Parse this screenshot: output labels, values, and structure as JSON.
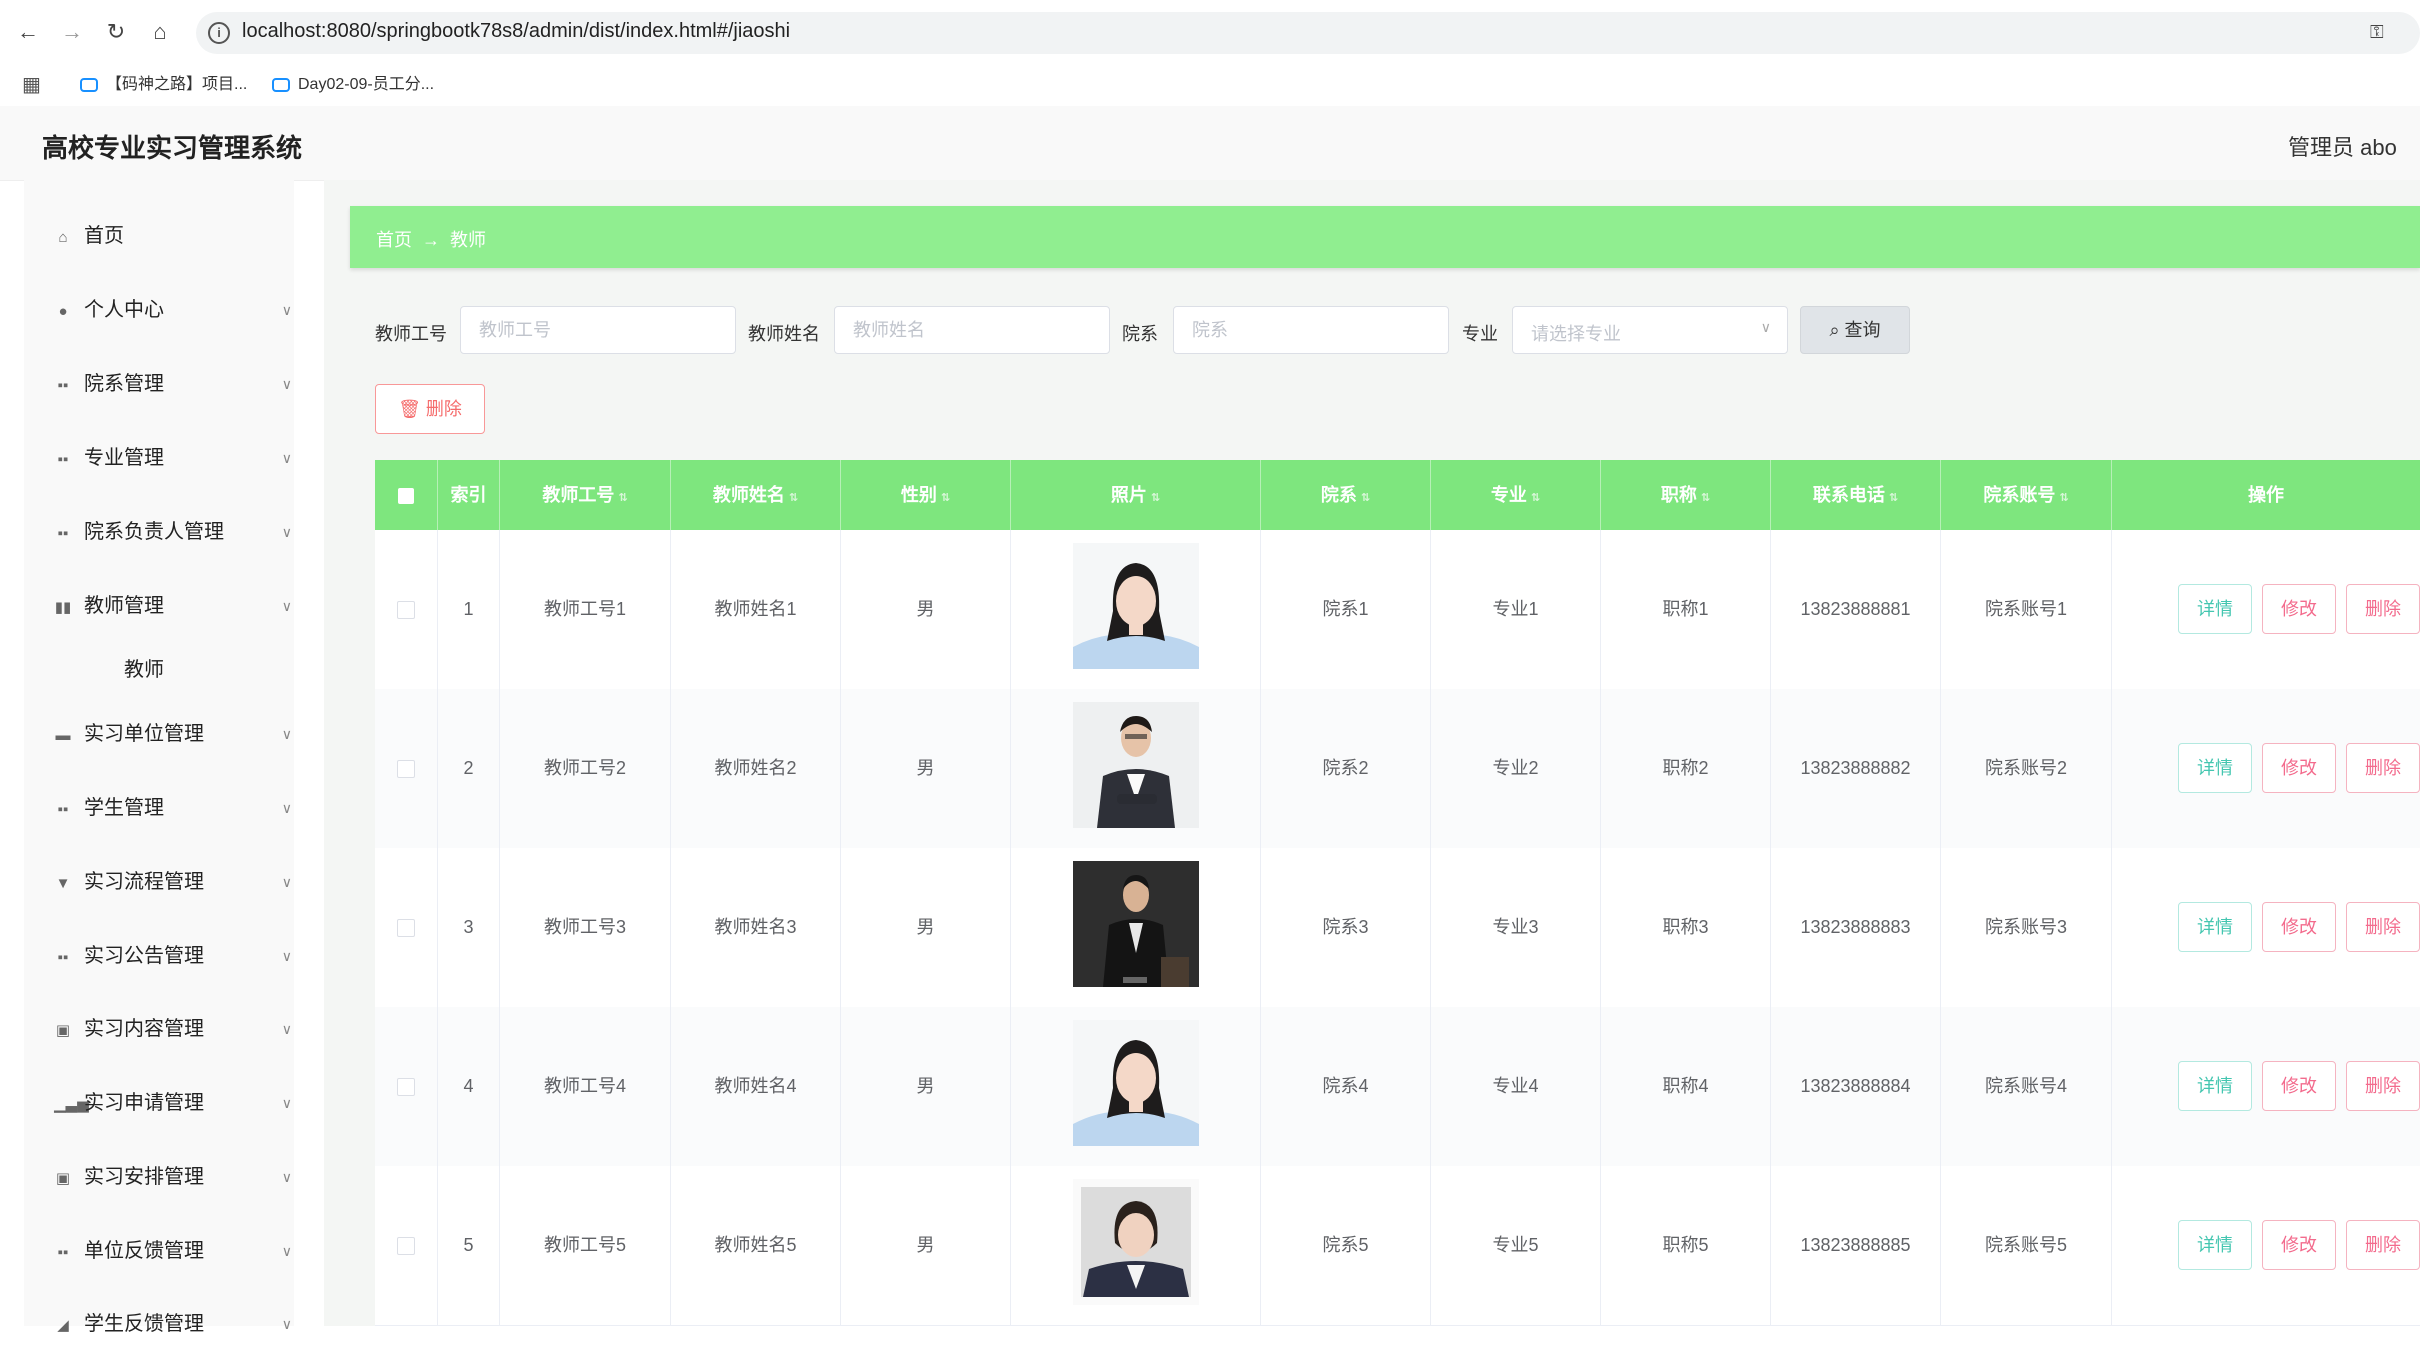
{
  "browser": {
    "url": "localhost:8080/springbootk78s8/admin/dist/index.html#/jiaoshi",
    "bookmarks": [
      {
        "label": "【码神之路】项目..."
      },
      {
        "label": "Day02-09-员工分..."
      }
    ]
  },
  "header": {
    "title": "高校专业实习管理系统",
    "user": "管理员 abo"
  },
  "sidebar": {
    "items": [
      {
        "label": "首页",
        "icon": "home-icon"
      },
      {
        "label": "个人中心",
        "icon": "user-icon"
      },
      {
        "label": "院系管理",
        "icon": "grid-icon"
      },
      {
        "label": "专业管理",
        "icon": "grid-icon"
      },
      {
        "label": "院系负责人管理",
        "icon": "grid-icon"
      },
      {
        "label": "教师管理",
        "icon": "chart-icon"
      },
      {
        "label": "实习单位管理",
        "icon": "ticket-icon"
      },
      {
        "label": "学生管理",
        "icon": "grid-icon"
      },
      {
        "label": "实习流程管理",
        "icon": "flag-icon"
      },
      {
        "label": "实习公告管理",
        "icon": "grid-icon"
      },
      {
        "label": "实习内容管理",
        "icon": "clipboard-icon"
      },
      {
        "label": "实习申请管理",
        "icon": "bar-chart-icon"
      },
      {
        "label": "实习安排管理",
        "icon": "clipboard-icon"
      },
      {
        "label": "单位反馈管理",
        "icon": "grid-icon"
      },
      {
        "label": "学生反馈管理",
        "icon": "send-icon"
      }
    ],
    "submenu": {
      "label": "教师"
    }
  },
  "breadcrumb": {
    "home": "首页",
    "current": "教师"
  },
  "search": {
    "teacher_no_label": "教师工号",
    "teacher_no_placeholder": "教师工号",
    "teacher_name_label": "教师姓名",
    "teacher_name_placeholder": "教师姓名",
    "dept_label": "院系",
    "dept_placeholder": "院系",
    "major_label": "专业",
    "major_placeholder": "请选择专业",
    "query_label": "查询"
  },
  "actions": {
    "delete_label": "删除"
  },
  "table": {
    "columns": [
      "索引",
      "教师工号",
      "教师姓名",
      "性别",
      "照片",
      "院系",
      "专业",
      "职称",
      "联系电话",
      "院系账号",
      "操作"
    ],
    "rows": [
      {
        "index": "1",
        "teacher_no": "教师工号1",
        "teacher_name": "教师姓名1",
        "gender": "男",
        "dept": "院系1",
        "major": "专业1",
        "title": "职称1",
        "phone": "13823888881",
        "account": "院系账号1"
      },
      {
        "index": "2",
        "teacher_no": "教师工号2",
        "teacher_name": "教师姓名2",
        "gender": "男",
        "dept": "院系2",
        "major": "专业2",
        "title": "职称2",
        "phone": "13823888882",
        "account": "院系账号2"
      },
      {
        "index": "3",
        "teacher_no": "教师工号3",
        "teacher_name": "教师姓名3",
        "gender": "男",
        "dept": "院系3",
        "major": "专业3",
        "title": "职称3",
        "phone": "13823888883",
        "account": "院系账号3"
      },
      {
        "index": "4",
        "teacher_no": "教师工号4",
        "teacher_name": "教师姓名4",
        "gender": "男",
        "dept": "院系4",
        "major": "专业4",
        "title": "职称4",
        "phone": "13823888884",
        "account": "院系账号4"
      },
      {
        "index": "5",
        "teacher_no": "教师工号5",
        "teacher_name": "教师姓名5",
        "gender": "男",
        "dept": "院系5",
        "major": "专业5",
        "title": "职称5",
        "phone": "13823888885",
        "account": "院系账号5"
      }
    ],
    "op_labels": {
      "detail": "详情",
      "edit": "修改",
      "delete": "删除"
    }
  },
  "colors": {
    "accent": "#90ee90",
    "table_header": "#7ee67e",
    "danger": "#f56c6c",
    "detail": "#44c6b0"
  }
}
